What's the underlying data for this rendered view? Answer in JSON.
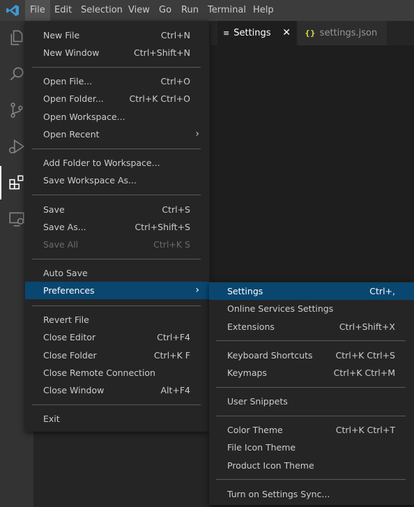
{
  "menubar": {
    "items": [
      "File",
      "Edit",
      "Selection",
      "View",
      "Go",
      "Run",
      "Terminal",
      "Help"
    ]
  },
  "tabs": [
    {
      "label": "Settings",
      "icon": "lines-icon",
      "active": true
    },
    {
      "label": "settings.json",
      "icon": "braces-icon",
      "active": false
    }
  ],
  "tab_icons": {
    "settings": "≡",
    "json": "{}",
    "close": "✕"
  },
  "file_menu": {
    "new_file": "New File",
    "new_file_key": "Ctrl+N",
    "new_window": "New Window",
    "new_window_key": "Ctrl+Shift+N",
    "open_file": "Open File...",
    "open_file_key": "Ctrl+O",
    "open_folder": "Open Folder...",
    "open_folder_key": "Ctrl+K Ctrl+O",
    "open_workspace": "Open Workspace...",
    "open_recent": "Open Recent",
    "add_folder": "Add Folder to Workspace...",
    "save_workspace_as": "Save Workspace As...",
    "save": "Save",
    "save_key": "Ctrl+S",
    "save_as": "Save As...",
    "save_as_key": "Ctrl+Shift+S",
    "save_all": "Save All",
    "save_all_key": "Ctrl+K S",
    "auto_save": "Auto Save",
    "preferences": "Preferences",
    "revert_file": "Revert File",
    "close_editor": "Close Editor",
    "close_editor_key": "Ctrl+F4",
    "close_folder": "Close Folder",
    "close_folder_key": "Ctrl+K F",
    "close_remote": "Close Remote Connection",
    "close_window": "Close Window",
    "close_window_key": "Alt+F4",
    "exit": "Exit"
  },
  "pref_menu": {
    "settings": "Settings",
    "settings_key": "Ctrl+,",
    "online_services": "Online Services Settings",
    "extensions": "Extensions",
    "extensions_key": "Ctrl+Shift+X",
    "keyboard_shortcuts": "Keyboard Shortcuts",
    "keyboard_shortcuts_key": "Ctrl+K Ctrl+S",
    "keymaps": "Keymaps",
    "keymaps_key": "Ctrl+K Ctrl+M",
    "user_snippets": "User Snippets",
    "color_theme": "Color Theme",
    "color_theme_key": "Ctrl+K Ctrl+T",
    "file_icon_theme": "File Icon Theme",
    "product_icon_theme": "Product Icon Theme",
    "settings_sync": "Turn on Settings Sync..."
  },
  "arrow": "›",
  "colors": {
    "highlight": "#094771",
    "logo": "#3c99d4",
    "json_icon": "#cbcb41"
  }
}
